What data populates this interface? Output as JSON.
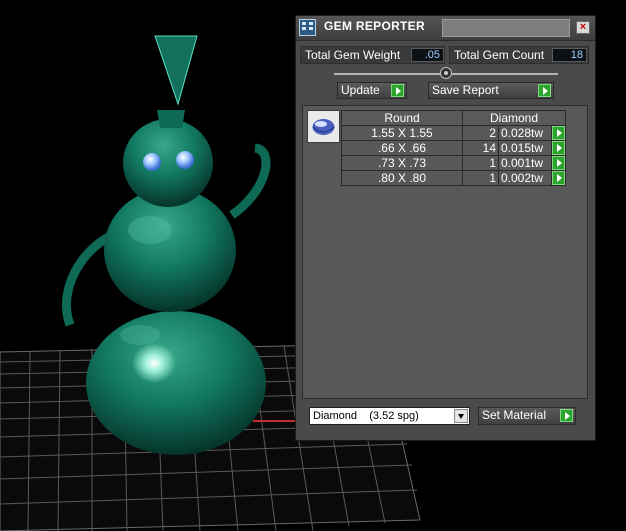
{
  "window": {
    "title": "GEM REPORTER",
    "close_label": "×"
  },
  "totals": {
    "weight_label": "Total Gem Weight",
    "weight_value": ".05",
    "count_label": "Total Gem Count",
    "count_value": "18"
  },
  "toolbar": {
    "update_label": "Update",
    "save_label": "Save Report"
  },
  "table": {
    "columns": [
      "Round",
      "Diamond"
    ],
    "rows": [
      {
        "size": "1.55 X 1.55",
        "count": "2",
        "weight": "0.028tw"
      },
      {
        "size": ".66 X .66",
        "count": "14",
        "weight": "0.015tw"
      },
      {
        "size": ".73 X .73",
        "count": "1",
        "weight": "0.001tw"
      },
      {
        "size": ".80 X .80",
        "count": "1",
        "weight": "0.002tw"
      }
    ]
  },
  "material": {
    "selected": "Diamond    (3.52 spg)",
    "set_label": "Set Material"
  },
  "colors": {
    "model_green": "#12705c",
    "accent_green": "#2da42d",
    "panel_bg": "#4a4a4a"
  }
}
